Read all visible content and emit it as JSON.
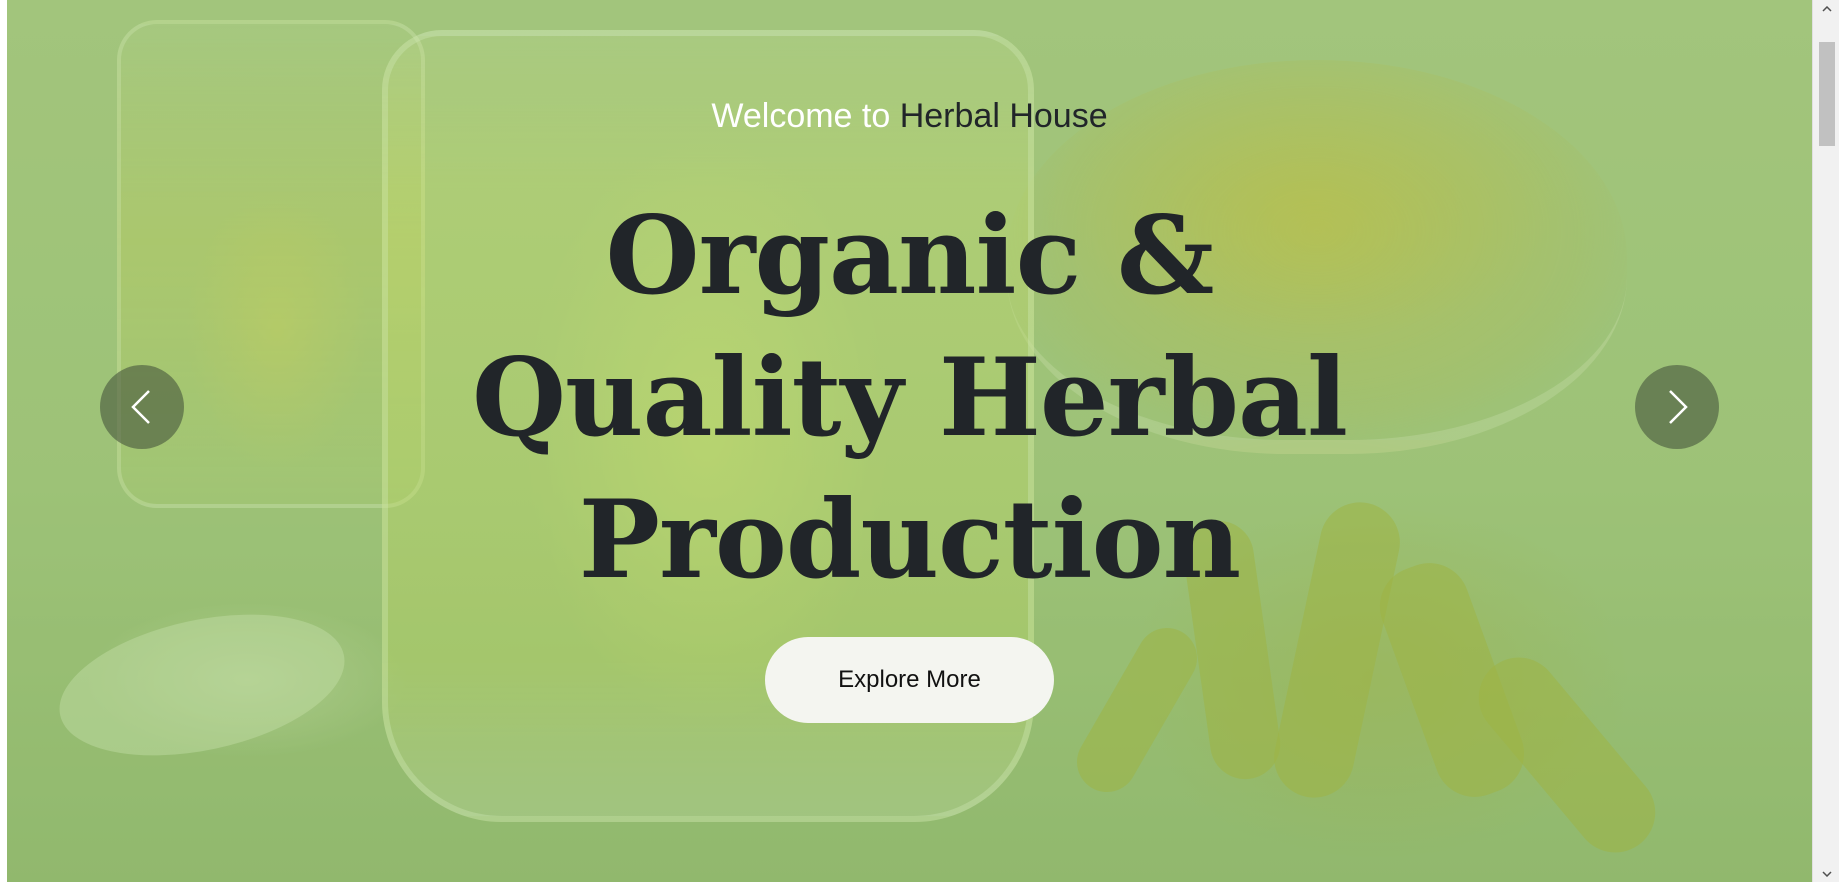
{
  "hero": {
    "welcome_prefix": "Welcome to",
    "welcome_brand": "Herbal House",
    "headline_lines": [
      "Organic &",
      "Quality Herbal",
      "Production"
    ],
    "cta_label": "Explore More"
  },
  "carousel": {
    "prev_icon": "chevron-left-icon",
    "next_icon": "chevron-right-icon"
  },
  "colors": {
    "overlay_green": "#a6c680",
    "headline_text": "#212529",
    "button_bg": "#f4f5f0"
  }
}
